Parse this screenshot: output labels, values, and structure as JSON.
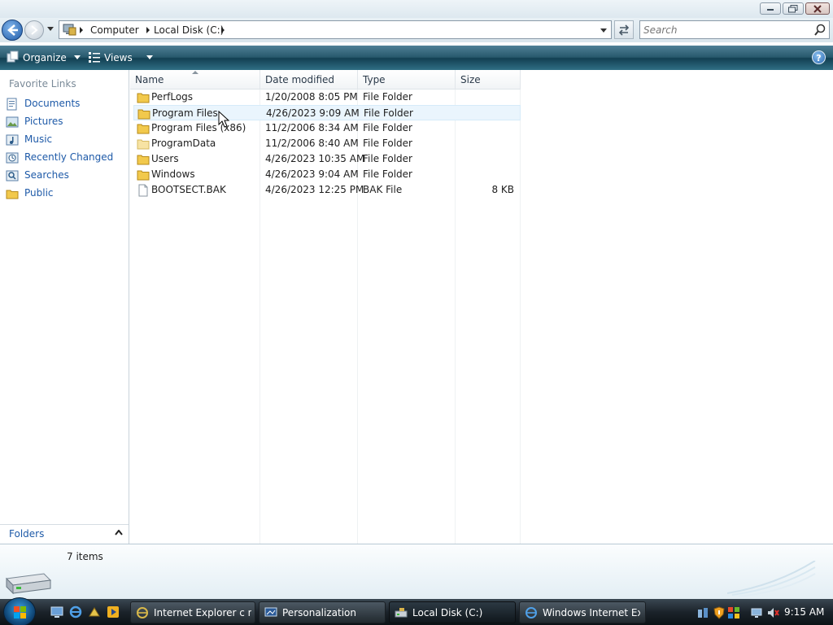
{
  "window": {
    "buttons": {
      "minimize": "minimize",
      "maximize": "maximize",
      "close": "close"
    }
  },
  "address": {
    "breadcrumbs": [
      "Computer",
      "Local Disk (C:)"
    ],
    "search_placeholder": "Search"
  },
  "toolbar": {
    "organize_label": "Organize",
    "views_label": "Views",
    "help_label": "?"
  },
  "navpane": {
    "header": "Favorite Links",
    "items": [
      {
        "label": "Documents",
        "icon": "documents-icon"
      },
      {
        "label": "Pictures",
        "icon": "pictures-icon"
      },
      {
        "label": "Music",
        "icon": "music-icon"
      },
      {
        "label": "Recently Changed",
        "icon": "recently-changed-icon"
      },
      {
        "label": "Searches",
        "icon": "searches-icon"
      },
      {
        "label": "Public",
        "icon": "public-folder-icon"
      }
    ],
    "folders_label": "Folders"
  },
  "files": {
    "columns": [
      "Name",
      "Date modified",
      "Type",
      "Size"
    ],
    "rows": [
      {
        "name": "PerfLogs",
        "date": "1/20/2008 8:05 PM",
        "type": "File Folder",
        "size": ""
      },
      {
        "name": "Program Files",
        "date": "4/26/2023 9:09 AM",
        "type": "File Folder",
        "size": ""
      },
      {
        "name": "Program Files (x86)",
        "date": "11/2/2006 8:34 AM",
        "type": "File Folder",
        "size": ""
      },
      {
        "name": "ProgramData",
        "date": "11/2/2006 8:40 AM",
        "type": "File Folder",
        "size": ""
      },
      {
        "name": "Users",
        "date": "4/26/2023 10:35 AM",
        "type": "File Folder",
        "size": ""
      },
      {
        "name": "Windows",
        "date": "4/26/2023 9:04 AM",
        "type": "File Folder",
        "size": ""
      },
      {
        "name": "BOOTSECT.BAK",
        "date": "4/26/2023 12:25 PM",
        "type": "BAK File",
        "size": "8 KB"
      }
    ]
  },
  "details": {
    "item_count": "7 items"
  },
  "taskbar": {
    "tasks": [
      {
        "label": "Internet Explorer c n...",
        "icon": "ie-icon"
      },
      {
        "label": "Personalization",
        "icon": "personalization-icon"
      },
      {
        "label": "Local Disk (C:)",
        "icon": "local-disk-icon"
      },
      {
        "label": "Windows Internet Ex...",
        "icon": "ie-icon"
      }
    ],
    "clock": "9:15 AM"
  },
  "colors": {
    "link": "#1e5aa8",
    "toolbar": "#27586c",
    "taskbar": "#1b232a"
  }
}
